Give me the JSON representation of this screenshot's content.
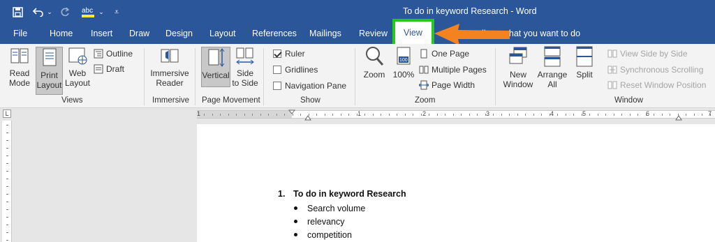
{
  "window": {
    "title": "To do in keyword Research  -  Word"
  },
  "colors": {
    "ribbon_blue": "#2b579a",
    "highlight_green": "#27c71f",
    "arrow_orange": "#f4821f"
  },
  "quick_access": [
    {
      "icon": "save-icon"
    },
    {
      "icon": "undo-icon"
    },
    {
      "icon": "redo-icon"
    },
    {
      "icon": "spelling-icon"
    },
    {
      "icon": "customize-qat-icon"
    }
  ],
  "tabs": [
    "File",
    "Home",
    "Insert",
    "Draw",
    "Design",
    "Layout",
    "References",
    "Mailings",
    "Review",
    "View"
  ],
  "tell_me": "ll me what you want to do",
  "ribbon": {
    "views": {
      "label": "Views",
      "read_mode": [
        "Read",
        "Mode"
      ],
      "print_layout": [
        "Print",
        "Layout"
      ],
      "web_layout": [
        "Web",
        "Layout"
      ],
      "outline": "Outline",
      "draft": "Draft"
    },
    "immersive": {
      "label": "Immersive",
      "reader": [
        "Immersive",
        "Reader"
      ]
    },
    "page_movement": {
      "label": "Page Movement",
      "vertical": "Vertical",
      "side_to_side": [
        "Side",
        "to Side"
      ]
    },
    "show": {
      "label": "Show",
      "ruler": "Ruler",
      "ruler_checked": true,
      "gridlines": "Gridlines",
      "navigation_pane": "Navigation Pane"
    },
    "zoom": {
      "label": "Zoom",
      "zoom": "Zoom",
      "percent": "100%",
      "one_page": "One Page",
      "multiple_pages": "Multiple Pages",
      "page_width": "Page Width"
    },
    "window": {
      "label": "Window",
      "new_window": [
        "New",
        "Window"
      ],
      "arrange_all": [
        "Arrange",
        "All"
      ],
      "split": "Split",
      "view_side_by_side": "View Side by Side",
      "synchronous_scrolling": "Synchronous Scrolling",
      "reset_window_position": "Reset Window Position"
    }
  },
  "ruler": {
    "numbers": [
      "1",
      "1",
      "2",
      "3",
      "4",
      "5",
      "6",
      "7"
    ],
    "tab_selector": "L"
  },
  "document": {
    "heading_number": "1.",
    "heading": "To do in keyword Research",
    "bullets": [
      "Search volume",
      "relevancy",
      "competition"
    ]
  }
}
